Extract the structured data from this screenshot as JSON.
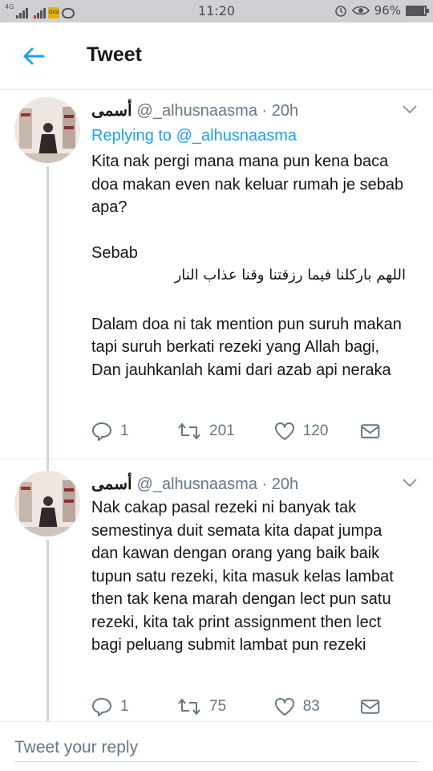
{
  "status_bar": {
    "network_tag": "4G",
    "carrier_badge": "DiGi",
    "time": "11:20",
    "battery_text": "96%",
    "battery_level": 0.96
  },
  "header": {
    "title": "Tweet"
  },
  "tweets": [
    {
      "display_name": "أسمى",
      "handle": "@_alhusnaasma",
      "time": "· 20h",
      "replying_prefix": "Replying to",
      "replying_to": "@_alhusnaasma",
      "text_1": "Kita nak pergi mana mana pun kena baca doa makan even nak keluar rumah je sebab apa?",
      "text_2": "Sebab",
      "text_arabic": "اللهم باركلنا فيما رزقتنا وقنا عذاب النار",
      "text_3": "Dalam doa ni tak mention pun suruh makan tapi suruh berkati rezeki yang Allah bagi, Dan jauhkanlah kami dari azab api neraka",
      "replies": "1",
      "retweets": "201",
      "likes": "120"
    },
    {
      "display_name": "أسمى",
      "handle": "@_alhusnaasma",
      "time": "· 20h",
      "text_1": "Nak cakap pasal rezeki ni banyak tak semestinya duit semata kita dapat jumpa dan kawan dengan orang yang baik baik tupun satu rezeki, kita masuk kelas lambat then tak kena marah dengan lect pun satu rezeki, kita tak print assignment then lect bagi peluang submit lambat pun rezeki",
      "replies": "1",
      "retweets": "75",
      "likes": "83"
    }
  ],
  "reply_bar": {
    "placeholder": "Tweet your reply"
  },
  "colors": {
    "accent": "#1da1f2",
    "muted": "#657786",
    "text": "#14171a"
  }
}
